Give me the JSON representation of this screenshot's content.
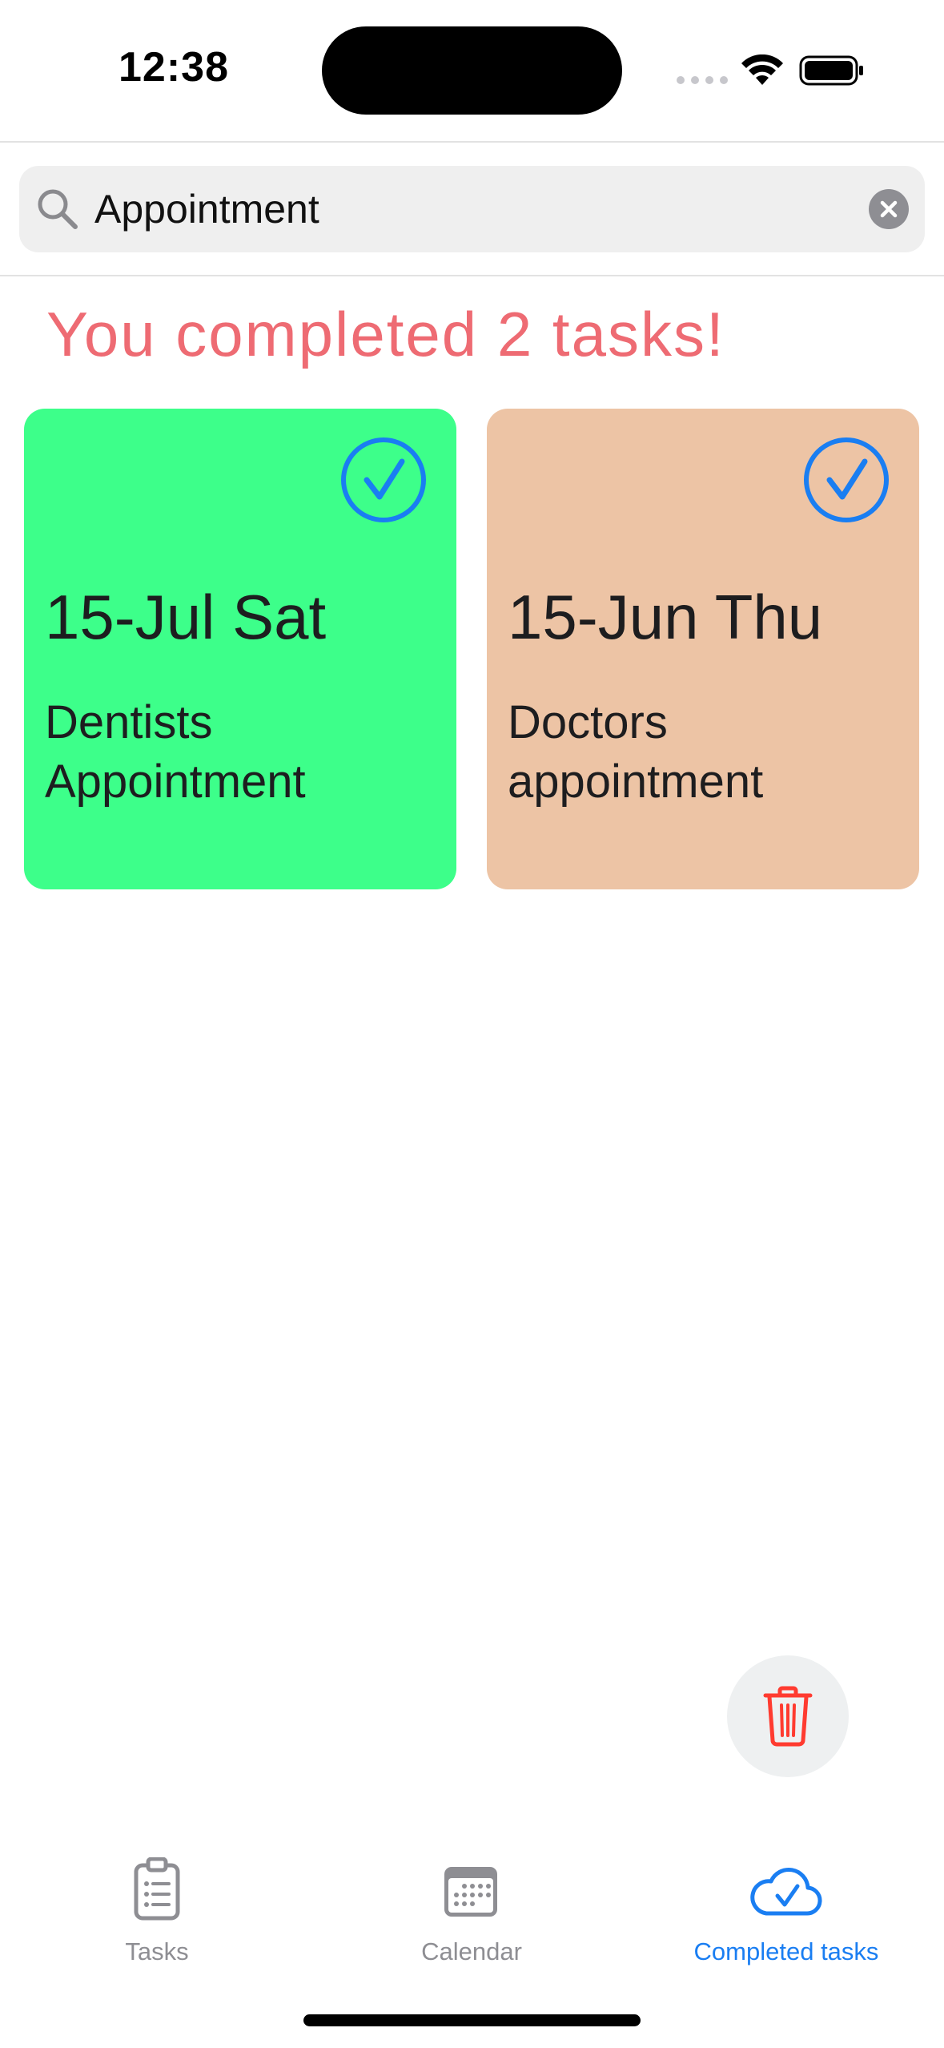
{
  "status_bar": {
    "time": "12:38"
  },
  "search": {
    "value": "Appointment"
  },
  "heading": {
    "text": "You completed 2 tasks!",
    "color": "#ee6b73"
  },
  "tasks": [
    {
      "date": "15-Jul Sat",
      "title": "Dentists Appointment",
      "color": "#3dff8a",
      "completed": true
    },
    {
      "date": "15-Jun Thu",
      "title": "Doctors appointment",
      "color": "#edc4a5",
      "completed": true
    }
  ],
  "tab_bar": {
    "active_color": "#1a7ef2",
    "inactive_color": "#8e8e93",
    "tabs": [
      {
        "label": "Tasks",
        "icon": "clipboard-list-icon",
        "active": false
      },
      {
        "label": "Calendar",
        "icon": "calendar-icon",
        "active": false
      },
      {
        "label": "Completed tasks",
        "icon": "cloud-check-icon",
        "active": true
      }
    ]
  },
  "actions": {
    "delete_icon": "trash-icon",
    "delete_color": "#ff3b30"
  }
}
